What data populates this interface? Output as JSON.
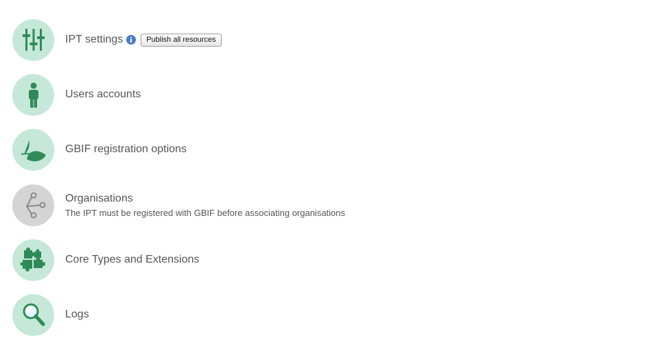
{
  "colors": {
    "icon_circle_bg": "#c5e8d8",
    "icon_circle_disabled_bg": "#d4d4d4",
    "icon_green": "#2e8b57",
    "icon_gray": "#8a8a8a",
    "info_blue": "#4b7fcf"
  },
  "items": [
    {
      "title": "IPT settings",
      "icon": "sliders-icon",
      "info_icon": "info-icon",
      "button_label": "Publish all resources"
    },
    {
      "title": "Users accounts",
      "icon": "person-icon"
    },
    {
      "title": "GBIF registration options",
      "icon": "leaf-icon"
    },
    {
      "title": "Organisations",
      "subtitle": "The IPT must be registered with GBIF before associating organisations",
      "icon": "share-network-icon",
      "disabled": true
    },
    {
      "title": "Core Types and Extensions",
      "icon": "puzzle-icon"
    },
    {
      "title": "Logs",
      "icon": "magnifier-icon"
    }
  ]
}
